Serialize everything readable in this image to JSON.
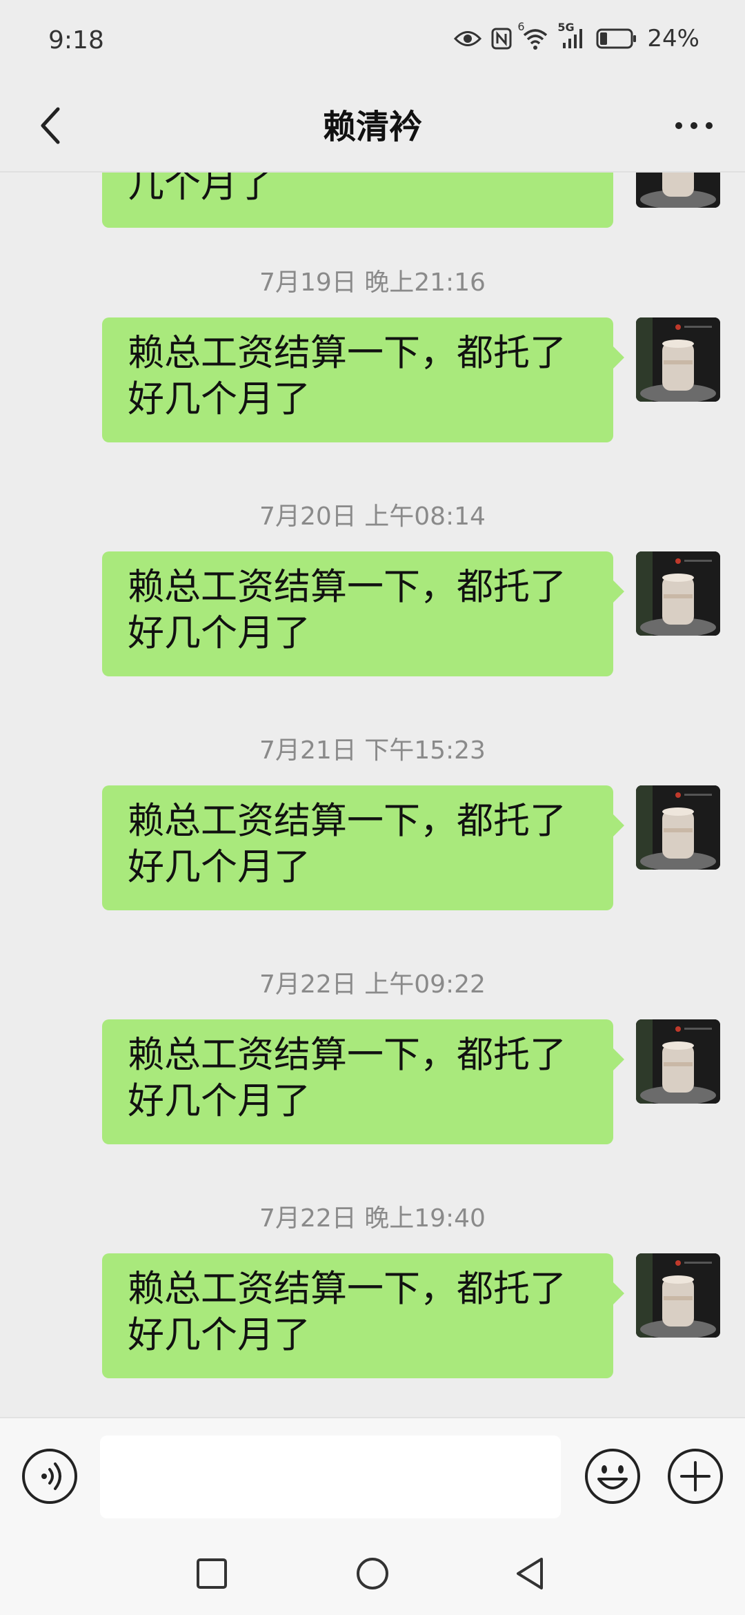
{
  "status_bar": {
    "time": "9:18",
    "network_small": "6",
    "network_gen": "5G",
    "battery_percent": "24%",
    "icons": [
      "eye-icon",
      "nfc-icon",
      "wifi-icon",
      "cellular-signal-icon",
      "battery-icon"
    ],
    "battery_level": 0.24
  },
  "header": {
    "title": "赖清衿",
    "back_icon": "chevron-left-icon",
    "more_icon": "ellipsis-icon"
  },
  "chat": {
    "bubble_color": "#a9e97c",
    "partial_top_message": "几个月了",
    "messages": [
      {
        "timestamp": "7月19日 晚上21:16",
        "text": "赖总工资结算一下，都托了好几个月了",
        "sender": "me"
      },
      {
        "timestamp": "7月20日 上午08:14",
        "text": "赖总工资结算一下，都托了好几个月了",
        "sender": "me"
      },
      {
        "timestamp": "7月21日 下午15:23",
        "text": "赖总工资结算一下，都托了好几个月了",
        "sender": "me"
      },
      {
        "timestamp": "7月22日 上午09:22",
        "text": "赖总工资结算一下，都托了好几个月了",
        "sender": "me"
      },
      {
        "timestamp": "7月22日 晚上19:40",
        "text": "赖总工资结算一下，都托了好几个月了",
        "sender": "me"
      }
    ]
  },
  "input_bar": {
    "value": "",
    "placeholder": "",
    "voice_icon": "voice-icon",
    "emoji_icon": "emoji-icon",
    "plus_icon": "plus-circle-icon"
  },
  "system_nav": {
    "icons": [
      "recent-apps-icon",
      "home-icon",
      "back-triangle-icon"
    ]
  }
}
